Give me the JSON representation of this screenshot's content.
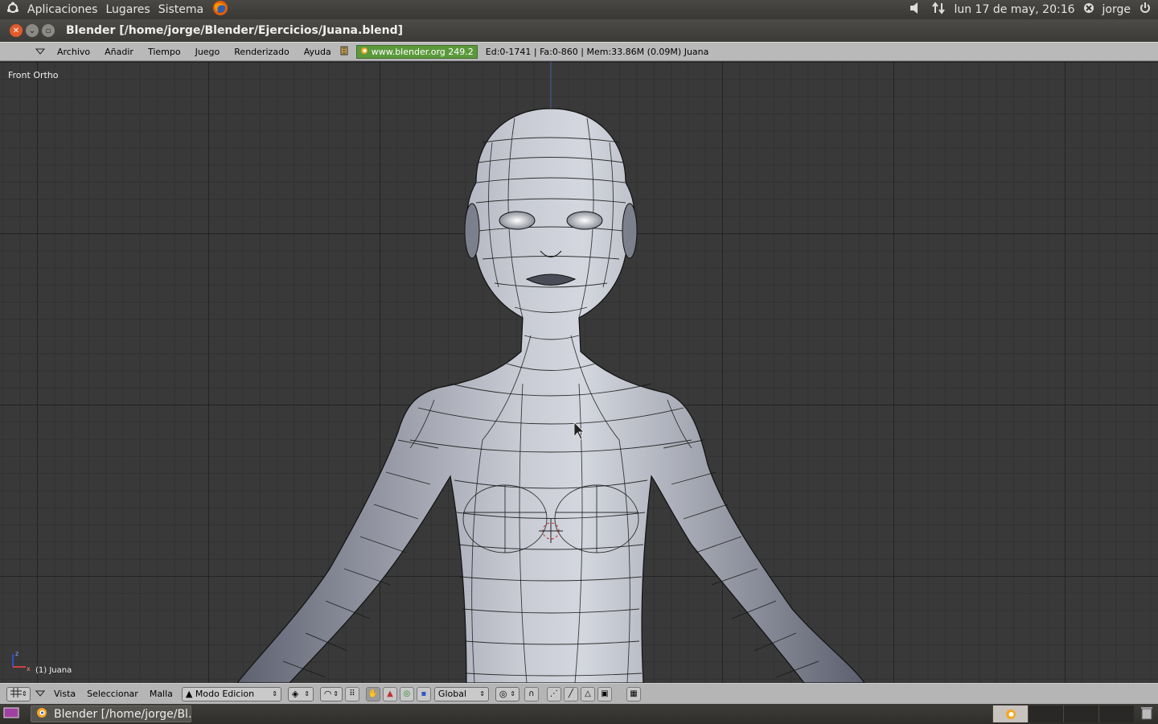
{
  "top_panel": {
    "menus": [
      "Aplicaciones",
      "Lugares",
      "Sistema"
    ],
    "datetime": "lun 17 de may, 20:16",
    "user": "jorge"
  },
  "window": {
    "title": "Blender [/home/jorge/Blender/Ejercicios/Juana.blend]"
  },
  "blender_header": {
    "menus": [
      "Archivo",
      "Añadir",
      "Tiempo",
      "Juego",
      "Renderizado",
      "Ayuda"
    ],
    "url_badge": "www.blender.org 249.2",
    "stats": "Ed:0-1741 | Fa:0-860 | Mem:33.86M (0.09M) Juana"
  },
  "viewport": {
    "view_label": "Front Ortho",
    "object_label": "(1) Juana"
  },
  "bottom_header": {
    "menus": [
      "Vista",
      "Seleccionar",
      "Malla"
    ],
    "mode": "Modo Edicion",
    "orientation": "Global"
  },
  "taskbar": {
    "task_label": "Blender [/home/jorge/Bl..."
  },
  "colors": {
    "panel": "#3c3b37",
    "blender_header": "#b9b9b9",
    "viewport": "#393939",
    "url_badge": "#5b9a3c",
    "close_button": "#e25a2a"
  }
}
